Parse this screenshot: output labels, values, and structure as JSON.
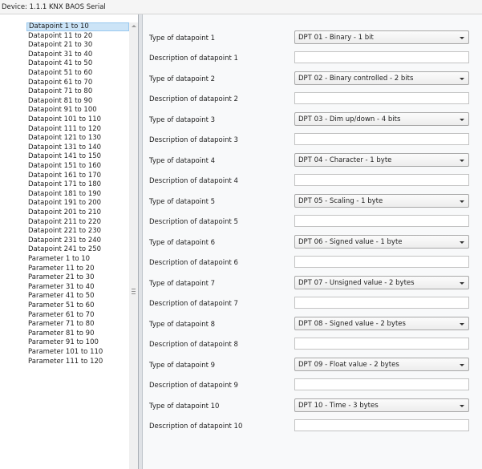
{
  "device_bar": {
    "label": "Device: 1.1.1  KNX BAOS Serial"
  },
  "sidebar": {
    "selected_index": 0,
    "items": [
      "Datapoint 1 to 10",
      "Datapoint 11 to 20",
      "Datapoint 21 to 30",
      "Datapoint 31 to 40",
      "Datapoint 41 to 50",
      "Datapoint 51 to 60",
      "Datapoint 61 to 70",
      "Datapoint 71 to 80",
      "Datapoint 81 to 90",
      "Datapoint 91 to 100",
      "Datapoint 101 to 110",
      "Datapoint 111 to 120",
      "Datapoint 121 to 130",
      "Datapoint 131 to 140",
      "Datapoint 141 to 150",
      "Datapoint 151 to 160",
      "Datapoint 161 to 170",
      "Datapoint 171 to 180",
      "Datapoint 181 to 190",
      "Datapoint 191 to 200",
      "Datapoint 201 to 210",
      "Datapoint 211 to 220",
      "Datapoint 221 to 230",
      "Datapoint 231 to 240",
      "Datapoint 241 to 250",
      "Parameter 1 to 10",
      "Parameter 11 to 20",
      "Parameter 21 to 30",
      "Parameter 31 to 40",
      "Parameter 41 to 50",
      "Parameter 51 to 60",
      "Parameter 61 to 70",
      "Parameter 71 to 80",
      "Parameter 81 to 90",
      "Parameter 91 to 100",
      "Parameter 101 to 110",
      "Parameter 111 to 120"
    ]
  },
  "datapoints": [
    {
      "type_label": "Type of datapoint 1",
      "type_value": "DPT 01 - Binary - 1 bit",
      "desc_label": "Description of datapoint 1",
      "desc_value": ""
    },
    {
      "type_label": "Type of datapoint 2",
      "type_value": "DPT 02 - Binary controlled - 2 bits",
      "desc_label": "Description of datapoint 2",
      "desc_value": ""
    },
    {
      "type_label": "Type of datapoint 3",
      "type_value": "DPT 03 - Dim up/down - 4 bits",
      "desc_label": "Description of datapoint 3",
      "desc_value": ""
    },
    {
      "type_label": "Type of datapoint 4",
      "type_value": "DPT 04 - Character - 1 byte",
      "desc_label": "Description of datapoint 4",
      "desc_value": ""
    },
    {
      "type_label": "Type of datapoint 5",
      "type_value": "DPT 05 - Scaling - 1 byte",
      "desc_label": "Description of datapoint 5",
      "desc_value": ""
    },
    {
      "type_label": "Type of datapoint 6",
      "type_value": "DPT 06 - Signed value - 1 byte",
      "desc_label": "Description of datapoint 6",
      "desc_value": ""
    },
    {
      "type_label": "Type of datapoint 7",
      "type_value": "DPT 07 - Unsigned value - 2 bytes",
      "desc_label": "Description of datapoint 7",
      "desc_value": ""
    },
    {
      "type_label": "Type of datapoint 8",
      "type_value": "DPT 08 - Signed value - 2 bytes",
      "desc_label": "Description of datapoint 8",
      "desc_value": ""
    },
    {
      "type_label": "Type of datapoint 9",
      "type_value": "DPT 09 - Float value - 2 bytes",
      "desc_label": "Description of datapoint 9",
      "desc_value": ""
    },
    {
      "type_label": "Type of datapoint 10",
      "type_value": "DPT 10 - Time - 3 bytes",
      "desc_label": "Description of datapoint 10",
      "desc_value": ""
    }
  ],
  "icons": {
    "scroll_up": "scroll-up-icon",
    "grip": "grip-icon",
    "dropdown": "chevron-down-icon"
  },
  "colors": {
    "selection": "#cce4f7",
    "selection_border": "#99c9ef"
  }
}
